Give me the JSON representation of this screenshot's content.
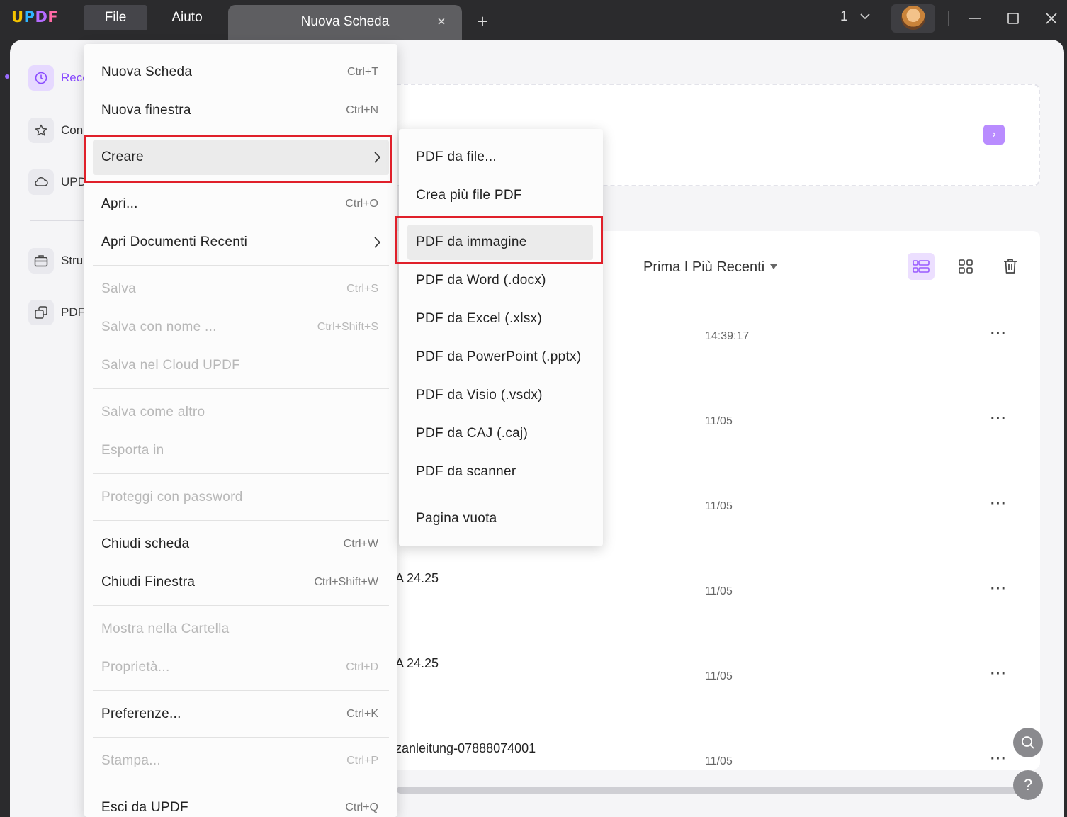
{
  "titlebar": {
    "logo": [
      "U",
      "P",
      "D",
      "F"
    ],
    "menu_file": "File",
    "menu_help": "Aiuto",
    "tab_title": "Nuova Scheda",
    "tab_close": "×",
    "tab_add": "+",
    "window_count": "1"
  },
  "sidebar": {
    "items": [
      {
        "label": "Rece",
        "icon": "clock-icon"
      },
      {
        "label": "Con",
        "icon": "star-icon"
      },
      {
        "label": "UPD",
        "icon": "cloud-icon"
      },
      {
        "label": "Stru",
        "icon": "toolbox-icon"
      },
      {
        "label": "PDF",
        "icon": "copy-icon"
      }
    ]
  },
  "content": {
    "drop_arrow": "›",
    "sort_label": "Prima I Più Recenti",
    "rows": [
      {
        "name": "",
        "time": "14:39:17",
        "more": "···"
      },
      {
        "name": "",
        "time": "11/05",
        "more": "···"
      },
      {
        "name": "",
        "time": "11/05",
        "more": "···"
      },
      {
        "name": "A 24.25",
        "time": "11/05",
        "more": "···"
      },
      {
        "name": "A 24.25",
        "time": "11/05",
        "more": "···"
      },
      {
        "name": "zanleitung-07888074001",
        "time": "11/05",
        "more": "···"
      }
    ],
    "help_glyph": "?"
  },
  "file_menu": {
    "items": [
      {
        "label": "Nuova Scheda",
        "shortcut": "Ctrl+T"
      },
      {
        "label": "Nuova finestra",
        "shortcut": "Ctrl+N"
      },
      {
        "label": "Creare",
        "shortcut": ""
      },
      {
        "label": "Apri...",
        "shortcut": "Ctrl+O"
      },
      {
        "label": "Apri Documenti Recenti",
        "shortcut": ""
      },
      {
        "label": "Salva",
        "shortcut": "Ctrl+S"
      },
      {
        "label": "Salva con nome ...",
        "shortcut": "Ctrl+Shift+S"
      },
      {
        "label": "Salva nel Cloud UPDF",
        "shortcut": ""
      },
      {
        "label": "Salva come altro",
        "shortcut": ""
      },
      {
        "label": "Esporta in",
        "shortcut": ""
      },
      {
        "label": "Proteggi con password",
        "shortcut": ""
      },
      {
        "label": "Chiudi scheda",
        "shortcut": "Ctrl+W"
      },
      {
        "label": "Chiudi Finestra",
        "shortcut": "Ctrl+Shift+W"
      },
      {
        "label": "Mostra nella Cartella",
        "shortcut": ""
      },
      {
        "label": "Proprietà...",
        "shortcut": "Ctrl+D"
      },
      {
        "label": "Preferenze...",
        "shortcut": "Ctrl+K"
      },
      {
        "label": "Stampa...",
        "shortcut": "Ctrl+P"
      },
      {
        "label": "Esci da UPDF",
        "shortcut": "Ctrl+Q"
      }
    ]
  },
  "create_submenu": {
    "items": [
      {
        "label": "PDF da file..."
      },
      {
        "label": "Crea più file PDF"
      },
      {
        "label": "PDF da immagine"
      },
      {
        "label": "PDF da Word (.docx)"
      },
      {
        "label": "PDF da Excel (.xlsx)"
      },
      {
        "label": "PDF da PowerPoint (.pptx)"
      },
      {
        "label": "PDF da Visio (.vsdx)"
      },
      {
        "label": "PDF da CAJ (.caj)"
      },
      {
        "label": "PDF da scanner"
      },
      {
        "label": "Pagina vuota"
      }
    ]
  },
  "colors": {
    "accent": "#8a4cff",
    "highlight_box": "#e0202a",
    "titlebar_bg": "#2b2b2d"
  }
}
